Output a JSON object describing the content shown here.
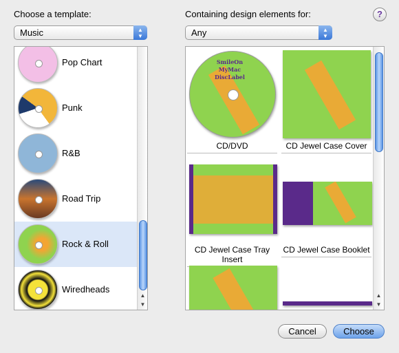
{
  "left": {
    "label": "Choose a template:",
    "category": "Music",
    "templates": [
      {
        "name": "Pop Chart",
        "color": "#f3bfe6"
      },
      {
        "name": "Punk",
        "color": "#f2b63a"
      },
      {
        "name": "R&B",
        "color": "#8fb6d8"
      },
      {
        "name": "Road Trip",
        "color": "#8a5a3a"
      },
      {
        "name": "Rock & Roll",
        "color": "#8fd34f",
        "selected": true
      },
      {
        "name": "Wiredheads",
        "color": "#f4e23a"
      }
    ]
  },
  "right": {
    "label": "Containing design elements for:",
    "filter": "Any",
    "elements": [
      {
        "name": "CD/DVD"
      },
      {
        "name": "CD Jewel Case Cover"
      },
      {
        "name": "CD Jewel Case Tray Insert"
      },
      {
        "name": "CD Jewel Case Booklet"
      }
    ],
    "art_text": "SmileOn MyMac DiscLabel"
  },
  "help": "?",
  "buttons": {
    "cancel": "Cancel",
    "choose": "Choose"
  }
}
